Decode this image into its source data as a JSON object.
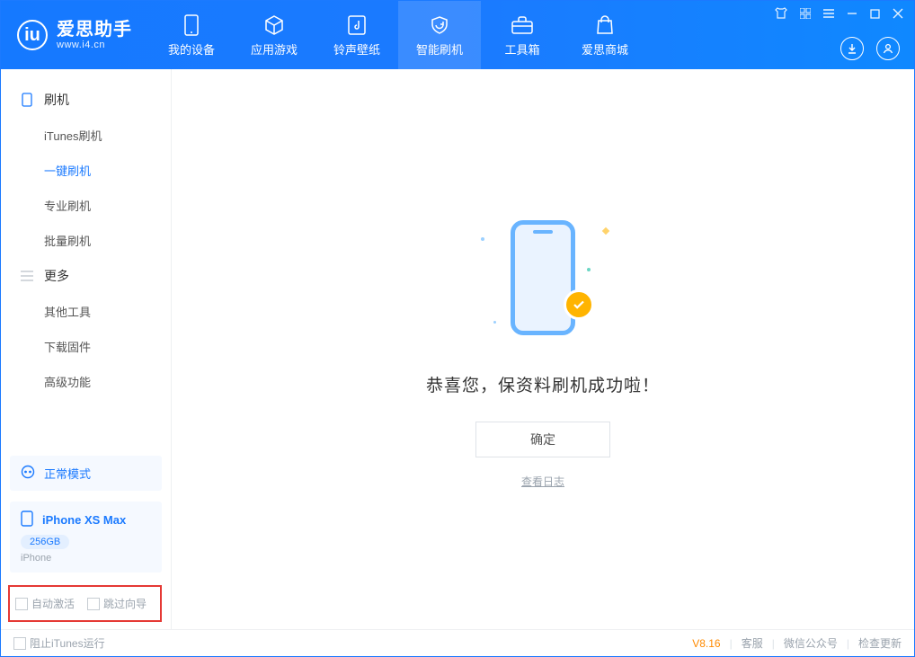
{
  "app": {
    "name": "爱思助手",
    "domain": "www.i4.cn"
  },
  "nav": {
    "items": [
      {
        "label": "我的设备"
      },
      {
        "label": "应用游戏"
      },
      {
        "label": "铃声壁纸"
      },
      {
        "label": "智能刷机"
      },
      {
        "label": "工具箱"
      },
      {
        "label": "爱思商城"
      }
    ],
    "active_index": 3
  },
  "sidebar": {
    "groups": [
      {
        "title": "刷机",
        "items": [
          "iTunes刷机",
          "一键刷机",
          "专业刷机",
          "批量刷机"
        ],
        "active_index": 1
      },
      {
        "title": "更多",
        "items": [
          "其他工具",
          "下载固件",
          "高级功能"
        ],
        "active_index": -1
      }
    ],
    "mode_panel": "正常模式",
    "device": {
      "name": "iPhone XS Max",
      "capacity": "256GB",
      "type": "iPhone"
    },
    "bottom_checks": [
      {
        "label": "自动激活",
        "checked": false
      },
      {
        "label": "跳过向导",
        "checked": false
      }
    ]
  },
  "main": {
    "success_text": "恭喜您，保资料刷机成功啦！",
    "ok_button": "确定",
    "log_link": "查看日志"
  },
  "footer": {
    "block_itunes": "阻止iTunes运行",
    "version": "V8.16",
    "links": [
      "客服",
      "微信公众号",
      "检查更新"
    ]
  }
}
